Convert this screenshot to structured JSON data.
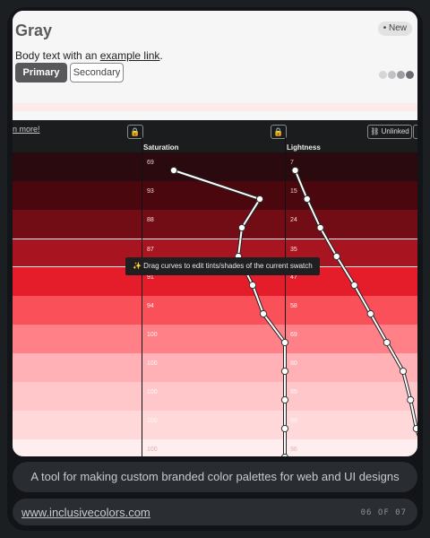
{
  "preview": {
    "title": "Gray",
    "badge": "• New",
    "body_prefix": "Body text with an ",
    "body_link": "example link",
    "body_suffix": ".",
    "primary_label": "Primary",
    "secondary_label": "Secondary",
    "dot_colors": [
      "#d6d6d8",
      "#c2c2c5",
      "#9e9ea2",
      "#6c6c70"
    ]
  },
  "editor": {
    "learn_more": "n more!",
    "unlinked_label": "Unlinked",
    "saturation_header": "Saturation",
    "lightness_header": "Lightness",
    "tooltip": "✨ Drag curves to edit tints/shades of the current swatch",
    "rows": [
      {
        "saturation": "69",
        "lightness": "7",
        "color": "#2a0a0e",
        "text": "#e6c9c9"
      },
      {
        "saturation": "93",
        "lightness": "15",
        "color": "#4a070d",
        "text": "#f2d4d4"
      },
      {
        "saturation": "88",
        "lightness": "24",
        "color": "#720d16",
        "text": "#f5dcdc"
      },
      {
        "saturation": "87",
        "lightness": "35",
        "color": "#a8141f",
        "text": "#fbe4e4"
      },
      {
        "saturation": "91",
        "lightness": "47",
        "color": "#e51d2a",
        "text": "#ffeaea"
      },
      {
        "saturation": "94",
        "lightness": "58",
        "color": "#f9505a",
        "text": "#fff1f1"
      },
      {
        "saturation": "100",
        "lightness": "69",
        "color": "#ff8087",
        "text": "#fff4f4"
      },
      {
        "saturation": "100",
        "lightness": "80",
        "color": "#ffb1b5",
        "text": "#fff8f8"
      },
      {
        "saturation": "100",
        "lightness": "85",
        "color": "#ffc7ca",
        "text": "#fff9f9"
      },
      {
        "saturation": "100",
        "lightness": "89",
        "color": "#ffd8da",
        "text": "#fffafa"
      },
      {
        "saturation": "100",
        "lightness": "96",
        "color": "#ffeeef",
        "text": "#e0b0b2"
      }
    ]
  },
  "tagline": "A tool for making custom branded color palettes for web and UI designs",
  "footer": {
    "url": "www.inclusivecolors.com",
    "pager": "06 OF 07"
  },
  "colors": {
    "frame": "#121417",
    "pill": "#292d32"
  }
}
